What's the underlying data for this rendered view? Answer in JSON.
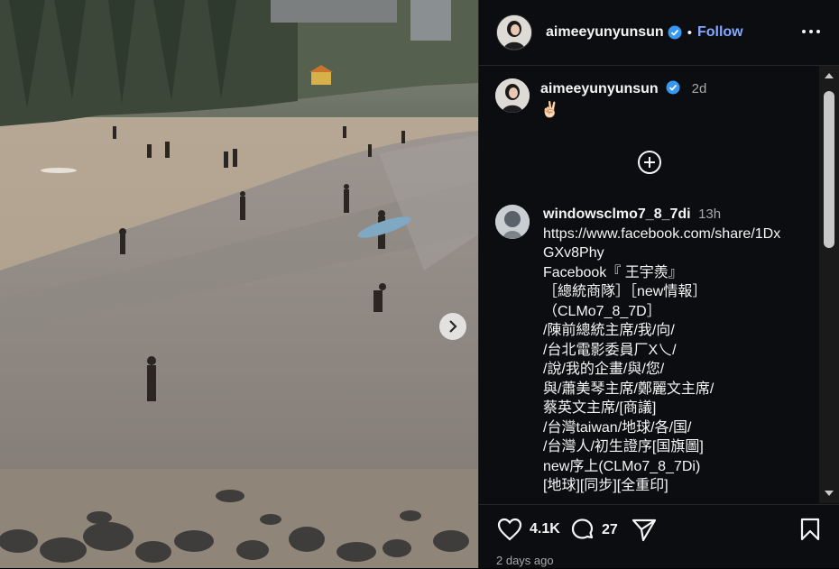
{
  "post": {
    "author": "aimeeyunyunsun",
    "follow_label": "Follow",
    "separator": "•",
    "caption_time": "2d",
    "caption_text": "✌🏻",
    "likes": "4.1K",
    "comments": "27",
    "posted_ago": "2 days ago"
  },
  "comment": {
    "author": "windowsclmo7_8_7di",
    "time": "13h",
    "lines": [
      "https://www.facebook.com/share/1Dx",
      "GXv8Phy",
      "Facebook『 王宇羨』",
      "［總統商隊］［new情報］",
      "（CLMo7_8_7D］",
      "/陳前總統主席/我/向/",
      "/台北電影委員厂X乀/",
      "/說/我的企畫/與/您/",
      "與/蕭美琴主席/鄭麗文主席/",
      "蔡英文主席/[商議]",
      "/台灣taiwan/地球/各/国/",
      "/台灣人/初生證序[国旗圖]",
      "new序上(CLMo7_8_7Di)",
      "[地球][同步][全重印]"
    ]
  },
  "colors": {
    "follow": "#85a9ff",
    "verified": "#3897f0",
    "panel_bg": "#0b0d10"
  },
  "icons": [
    "verified-badge-icon",
    "more-options-icon",
    "add-comment-icon",
    "heart-icon",
    "comment-icon",
    "share-icon",
    "bookmark-icon",
    "chevron-right-icon"
  ]
}
